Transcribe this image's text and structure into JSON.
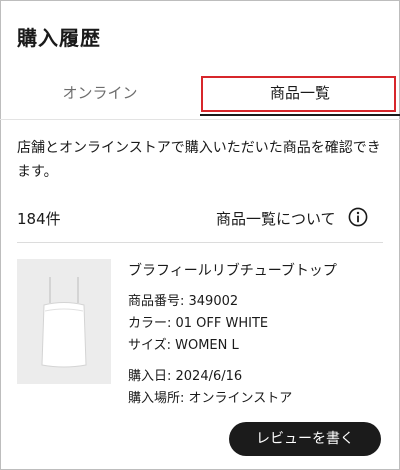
{
  "page_title": "購入履歴",
  "tabs": [
    {
      "label": "オンライン",
      "active": false
    },
    {
      "label": "商品一覧",
      "active": true
    }
  ],
  "description": "店舗とオンラインストアで購入いただいた商品を確認できます。",
  "item_count": "184件",
  "about_link": "商品一覧について",
  "icons": {
    "info": "info-circle-icon"
  },
  "item": {
    "name": "ブラフィールリブチューブトップ",
    "product_number": "商品番号: 349002",
    "color": "カラー: 01 OFF WHITE",
    "size": "サイズ: WOMEN L",
    "purchase_date": "購入日: 2024/6/16",
    "purchase_place": "購入場所: オンラインストア",
    "review_button": "レビューを書く"
  },
  "colors": {
    "highlight_border": "#d7262b",
    "button_bg": "#1b1b1b"
  }
}
